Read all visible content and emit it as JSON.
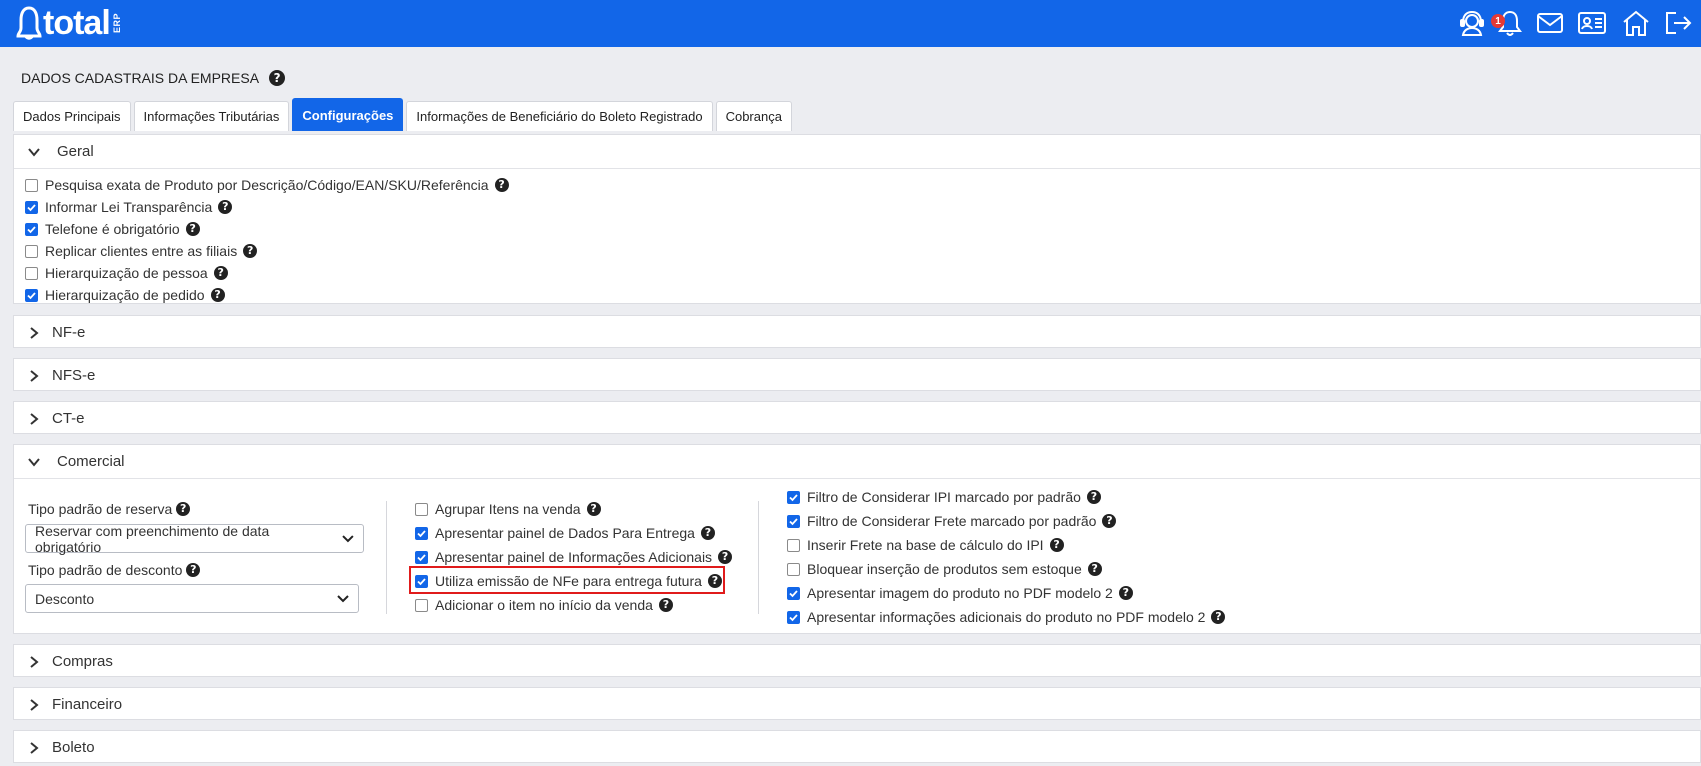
{
  "header": {
    "logo_text": "total",
    "logo_sub": "ERP",
    "notification_count": "1",
    "icons": [
      "support-agent-icon",
      "bell-icon",
      "mail-icon",
      "id-card-icon",
      "home-icon",
      "logout-icon"
    ]
  },
  "page": {
    "title": "DADOS CADASTRAIS DA EMPRESA",
    "help_glyph": "?"
  },
  "tabs": [
    {
      "label": "Dados Principais",
      "active": false
    },
    {
      "label": "Informações Tributárias",
      "active": false
    },
    {
      "label": "Configurações",
      "active": true
    },
    {
      "label": "Informações de Beneficiário do Boleto Registrado",
      "active": false
    },
    {
      "label": "Cobrança",
      "active": false
    }
  ],
  "sections": {
    "geral": {
      "title": "Geral",
      "expanded": true,
      "options": [
        {
          "label": "Pesquisa exata de Produto por Descrição/Código/EAN/SKU/Referência",
          "checked": false
        },
        {
          "label": "Informar Lei Transparência",
          "checked": true
        },
        {
          "label": "Telefone é obrigatório",
          "checked": true
        },
        {
          "label": "Replicar clientes entre as filiais",
          "checked": false
        },
        {
          "label": "Hierarquização de pessoa",
          "checked": false
        },
        {
          "label": "Hierarquização de pedido",
          "checked": true
        }
      ]
    },
    "nfe": {
      "title": "NF-e",
      "expanded": false
    },
    "nfse": {
      "title": "NFS-e",
      "expanded": false
    },
    "cte": {
      "title": "CT-e",
      "expanded": false
    },
    "comercial": {
      "title": "Comercial",
      "expanded": true,
      "reserva_label": "Tipo padrão de reserva",
      "reserva_value": "Reservar com preenchimento de data obrigatório",
      "desconto_label": "Tipo padrão de desconto",
      "desconto_value": "Desconto",
      "col2": [
        {
          "label": "Agrupar Itens na venda",
          "checked": false
        },
        {
          "label": "Apresentar painel de Dados Para Entrega",
          "checked": true
        },
        {
          "label": "Apresentar painel de Informações Adicionais",
          "checked": true
        },
        {
          "label": "Utiliza emissão de NFe para entrega futura",
          "checked": true,
          "highlighted": true
        },
        {
          "label": "Adicionar o item no início da venda",
          "checked": false
        }
      ],
      "col3": [
        {
          "label": "Filtro de Considerar IPI marcado por padrão",
          "checked": true
        },
        {
          "label": "Filtro de Considerar Frete marcado por padrão",
          "checked": true
        },
        {
          "label": "Inserir Frete na base de cálculo do IPI",
          "checked": false
        },
        {
          "label": "Bloquear inserção de produtos sem estoque",
          "checked": false
        },
        {
          "label": "Apresentar imagem do produto no PDF modelo 2",
          "checked": true
        },
        {
          "label": "Apresentar informações adicionais do produto no PDF modelo 2",
          "checked": true
        }
      ]
    },
    "compras": {
      "title": "Compras",
      "expanded": false
    },
    "financeiro": {
      "title": "Financeiro",
      "expanded": false
    },
    "boleto": {
      "title": "Boleto",
      "expanded": false
    }
  },
  "colors": {
    "brand": "#1266e8",
    "highlight": "#e01b1b",
    "badge": "#e53935"
  }
}
